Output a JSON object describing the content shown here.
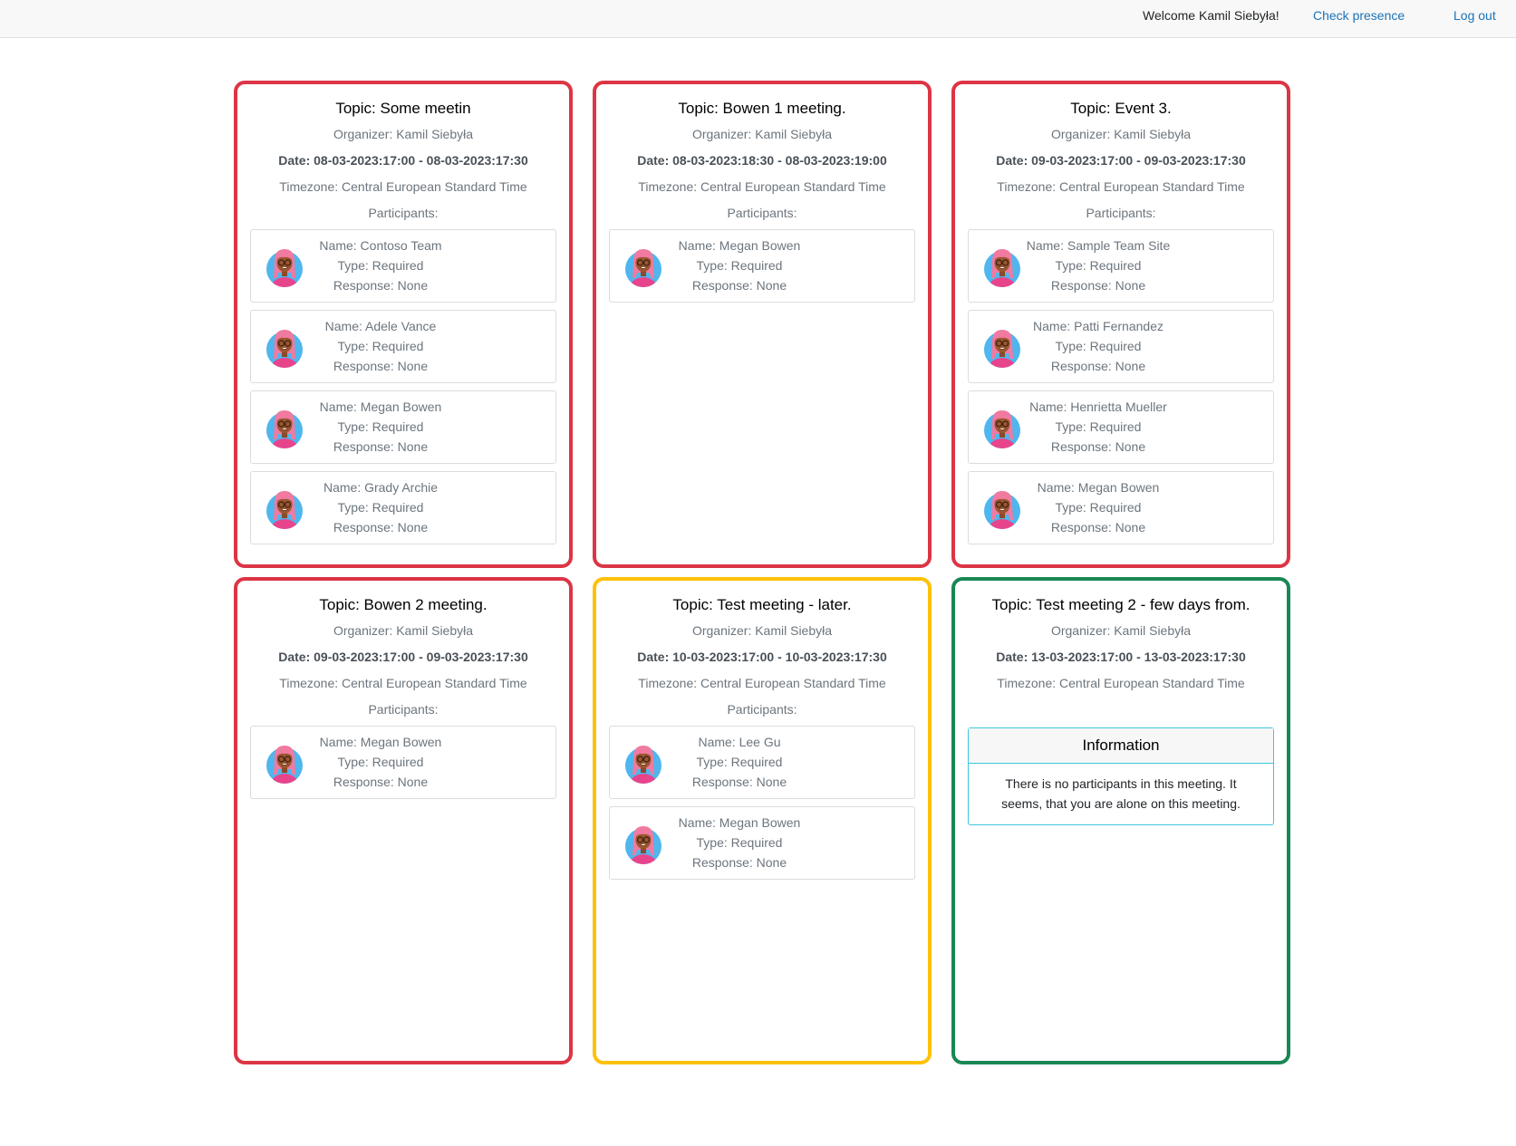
{
  "header": {
    "welcome": "Welcome Kamil Siebyła!",
    "check_presence": "Check presence",
    "logout": "Log out"
  },
  "meetings": [
    {
      "status": "red",
      "topic": "Topic: Some meetin",
      "organizer": "Organizer: Kamil Siebyła",
      "date": "Date: 08-03-2023:17:00 - 08-03-2023:17:30",
      "timezone": "Timezone: Central European Standard Time",
      "participants_label": "Participants:",
      "participants": [
        {
          "name": "Name: Contoso Team",
          "type": "Type: Required",
          "response": "Response: None"
        },
        {
          "name": "Name: Adele Vance",
          "type": "Type: Required",
          "response": "Response: None"
        },
        {
          "name": "Name: Megan Bowen",
          "type": "Type: Required",
          "response": "Response: None"
        },
        {
          "name": "Name: Grady Archie",
          "type": "Type: Required",
          "response": "Response: None"
        }
      ]
    },
    {
      "status": "red",
      "topic": "Topic: Bowen 1 meeting.",
      "organizer": "Organizer: Kamil Siebyła",
      "date": "Date: 08-03-2023:18:30 - 08-03-2023:19:00",
      "timezone": "Timezone: Central European Standard Time",
      "participants_label": "Participants:",
      "participants": [
        {
          "name": "Name: Megan Bowen",
          "type": "Type: Required",
          "response": "Response: None"
        }
      ]
    },
    {
      "status": "red",
      "topic": "Topic: Event 3.",
      "organizer": "Organizer: Kamil Siebyła",
      "date": "Date: 09-03-2023:17:00 - 09-03-2023:17:30",
      "timezone": "Timezone: Central European Standard Time",
      "participants_label": "Participants:",
      "participants": [
        {
          "name": "Name: Sample Team Site",
          "type": "Type: Required",
          "response": "Response: None"
        },
        {
          "name": "Name: Patti Fernandez",
          "type": "Type: Required",
          "response": "Response: None"
        },
        {
          "name": "Name: Henrietta Mueller",
          "type": "Type: Required",
          "response": "Response: None"
        },
        {
          "name": "Name: Megan Bowen",
          "type": "Type: Required",
          "response": "Response: None"
        }
      ]
    },
    {
      "status": "red",
      "topic": "Topic: Bowen 2 meeting.",
      "organizer": "Organizer: Kamil Siebyła",
      "date": "Date: 09-03-2023:17:00 - 09-03-2023:17:30",
      "timezone": "Timezone: Central European Standard Time",
      "participants_label": "Participants:",
      "participants": [
        {
          "name": "Name: Megan Bowen",
          "type": "Type: Required",
          "response": "Response: None"
        }
      ]
    },
    {
      "status": "yellow",
      "topic": "Topic: Test meeting - later.",
      "organizer": "Organizer: Kamil Siebyła",
      "date": "Date: 10-03-2023:17:00 - 10-03-2023:17:30",
      "timezone": "Timezone: Central European Standard Time",
      "participants_label": "Participants:",
      "participants": [
        {
          "name": "Name: Lee Gu",
          "type": "Type: Required",
          "response": "Response: None"
        },
        {
          "name": "Name: Megan Bowen",
          "type": "Type: Required",
          "response": "Response: None"
        }
      ]
    },
    {
      "status": "green",
      "topic": "Topic: Test meeting 2 - few days from.",
      "organizer": "Organizer: Kamil Siebyła",
      "date": "Date: 13-03-2023:17:00 - 13-03-2023:17:30",
      "timezone": "Timezone: Central European Standard Time",
      "info": {
        "title": "Information",
        "text": "There is no participants in this meeting. It seems, that you are alone on this meeting."
      }
    }
  ],
  "colors": {
    "red": "#dc3545",
    "yellow": "#ffc107",
    "green": "#198754",
    "link": "#1a73b8",
    "info_border": "#3ec6e0"
  }
}
